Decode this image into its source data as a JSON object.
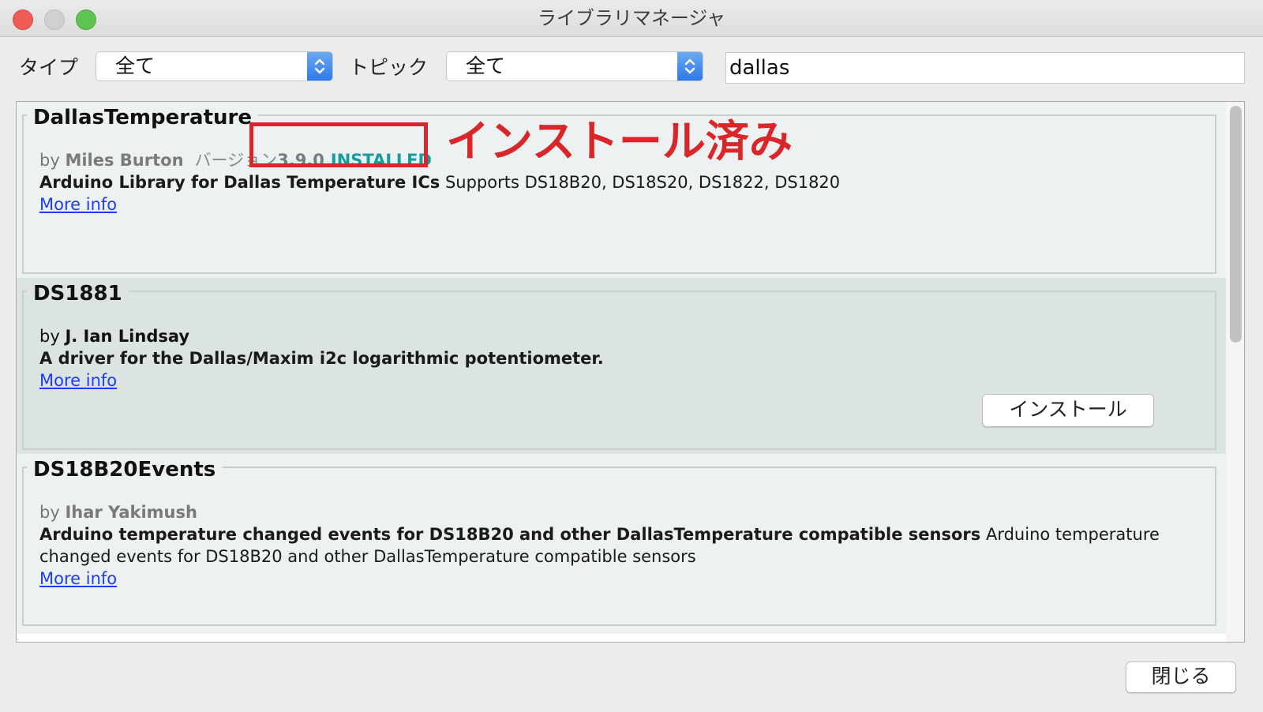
{
  "window": {
    "title": "ライブラリマネージャ"
  },
  "filters": {
    "type_label": "タイプ",
    "type_value": "全て",
    "topic_label": "トピック",
    "topic_value": "全て",
    "search_value": "dallas"
  },
  "libraries": [
    {
      "name": "DallasTemperature",
      "by": "by",
      "author": "Miles Burton",
      "version_label": "バージョン",
      "version": "3.9.0",
      "status": "INSTALLED",
      "desc_bold": "Arduino Library for Dallas Temperature ICs",
      "desc_rest": " Supports DS18B20, DS18S20, DS1822, DS1820",
      "more_info": "More info"
    },
    {
      "name": "DS1881",
      "by": "by",
      "author": "J. Ian Lindsay",
      "desc_bold": "A driver for the Dallas/Maxim i2c logarithmic potentiometer.",
      "desc_rest": "",
      "more_info": "More info",
      "install_label": "インストール"
    },
    {
      "name": "DS18B20Events",
      "by": "by",
      "author": "Ihar Yakimush",
      "desc_bold": "Arduino temperature changed events for DS18B20 and other DallasTemperature compatible sensors",
      "desc_rest": " Arduino temperature changed events for DS18B20 and other DallasTemperature compatible sensors",
      "more_info": "More info"
    }
  ],
  "annotation": {
    "text": "インストール済み",
    "color": "#d9262a"
  },
  "footer": {
    "close_label": "閉じる"
  },
  "icons": {
    "select_arrows": "up-down-chevron-icon"
  }
}
